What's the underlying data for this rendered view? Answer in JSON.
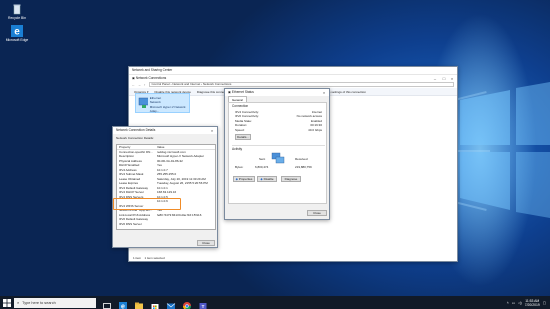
{
  "desktop": {
    "icons": [
      {
        "label": "Recycle Bin",
        "icon": "recycle-bin-icon"
      },
      {
        "label": "Microsoft Edge",
        "icon": "edge-icon"
      }
    ]
  },
  "netconn": {
    "title": "Network Connections",
    "parent_title": "Network and Sharing Center",
    "breadcrumb": [
      "Control Panel",
      "Network and Internet",
      "Network Connections"
    ],
    "commands": [
      "Organize ▾",
      "Disable this network device",
      "Diagnose this connection",
      "Rename this connection",
      "View status of this connection",
      "Change settings of this connection"
    ],
    "adapter": {
      "name": "Ethernet",
      "network": "Network",
      "device": "Microsoft Hyper-V Network Adap..."
    },
    "status": [
      "1 item",
      "1 item selected"
    ]
  },
  "eth": {
    "title": "Ethernet Status",
    "tab": "General",
    "connection_header": "Connection",
    "connection": [
      {
        "label": "IPv4 Connectivity:",
        "value": "Internet"
      },
      {
        "label": "IPv6 Connectivity:",
        "value": "No network access"
      },
      {
        "label": "Media State:",
        "value": "Enabled"
      },
      {
        "label": "Duration:",
        "value": "00:19:30"
      },
      {
        "label": "Speed:",
        "value": "40.0 Gbps"
      }
    ],
    "details_button": "Details...",
    "activity_header": "Activity",
    "sent_label": "Sent",
    "received_label": "Received",
    "bytes_label": "Bytes:",
    "bytes_sent": "6,800,474",
    "bytes_received": "219,880,759",
    "buttons": [
      "Properties",
      "Disable",
      "Diagnose"
    ],
    "close": "Close"
  },
  "details": {
    "title": "Network Connection Details",
    "subtitle": "Network Connection Details:",
    "columns": [
      "Property",
      "Value"
    ],
    "rows": [
      {
        "p": "Connection-specific DN...",
        "v": "reddog.microsoft.com"
      },
      {
        "p": "Description",
        "v": "Microsoft Hyper-V Network Adapter"
      },
      {
        "p": "Physical Address",
        "v": "00-0D-3A-91-86-32"
      },
      {
        "p": "DHCP Enabled",
        "v": "Yes"
      },
      {
        "p": "IPv4 Address",
        "v": "10.1.0.7"
      },
      {
        "p": "IPv4 Subnet Mask",
        "v": "255.255.255.0"
      },
      {
        "p": "Lease Obtained",
        "v": "Saturday, July 20, 2019 11:33:29 AM"
      },
      {
        "p": "Lease Expires",
        "v": "Tuesday, August 26, 2155 5:20:56 PM"
      },
      {
        "p": "IPv4 Default Gateway",
        "v": "10.1.0.1"
      },
      {
        "p": "IPv4 DHCP Server",
        "v": "168.63.129.16"
      },
      {
        "p": "IPv4 DNS Servers",
        "v": "10.1.0.5"
      },
      {
        "p": "",
        "v": "10.1.0.6"
      },
      {
        "p": "IPv4 WINS Server",
        "v": ""
      },
      {
        "p": "NetBIOS over Tcpip En...",
        "v": "Yes"
      },
      {
        "p": "Link-local IPv6 Address",
        "v": "fe80::5473:8413:bd4e:f16:15%16"
      },
      {
        "p": "IPv6 Default Gateway",
        "v": ""
      },
      {
        "p": "IPv6 DNS Server",
        "v": ""
      }
    ],
    "close": "Close"
  },
  "taskbar": {
    "search_placeholder": "Type here to search",
    "apps": [
      "task-view-icon",
      "edge-icon",
      "file-explorer-icon",
      "store-icon",
      "mail-icon",
      "chrome-icon",
      "teams-icon"
    ],
    "tray": {
      "time": "11:53 AM",
      "date": "7/20/2019"
    }
  }
}
